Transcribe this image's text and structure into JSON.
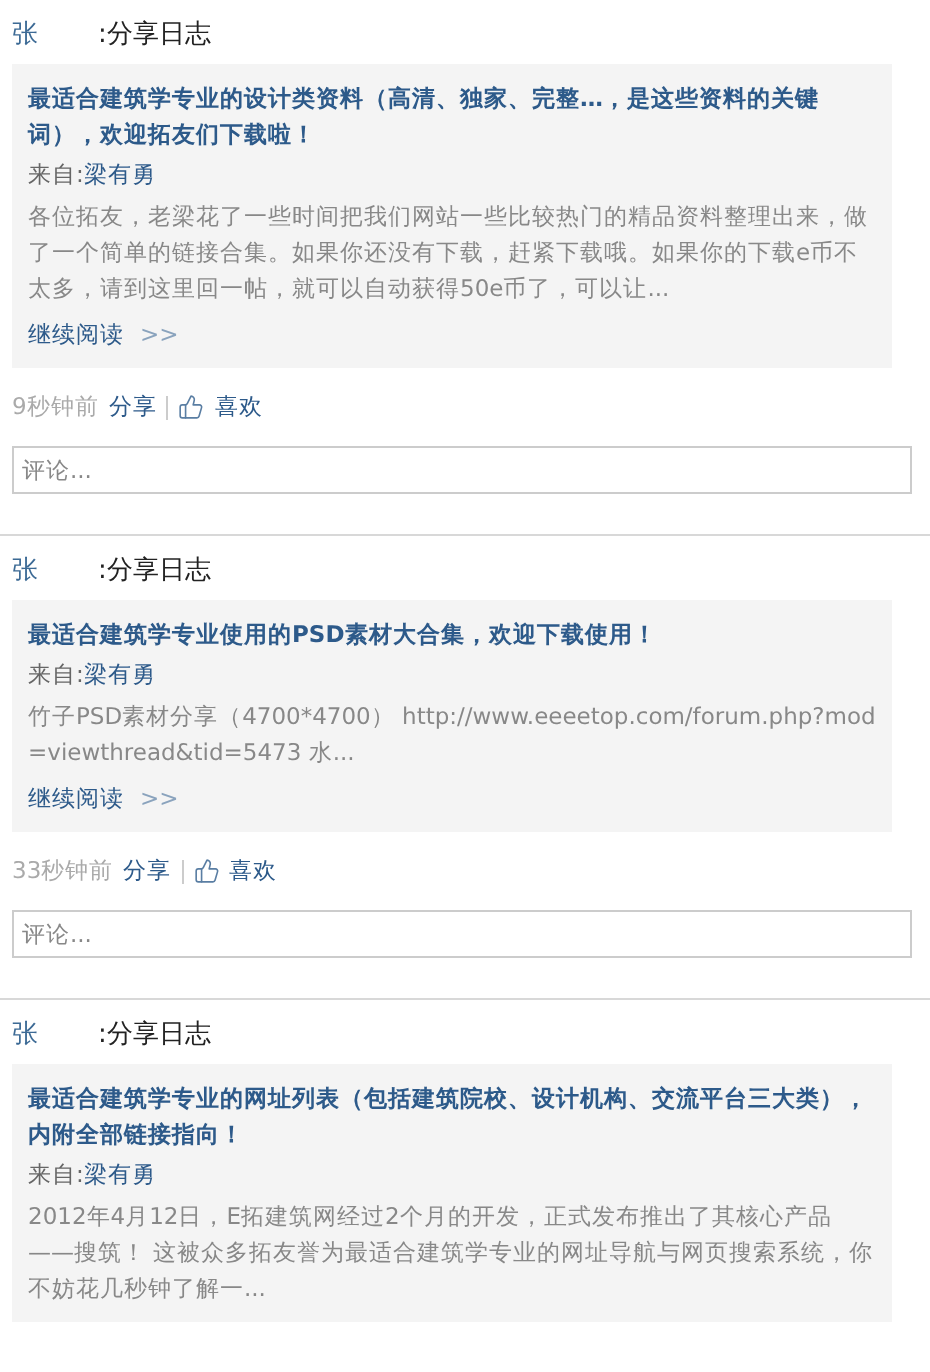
{
  "posts": [
    {
      "author": "张",
      "action": ":分享日志",
      "title": "最适合建筑学专业的设计类资料（高清、独家、完整…，是这些资料的关键词），欢迎拓友们下载啦！",
      "source_label": "来自:",
      "source": "梁有勇",
      "excerpt": "各位拓友，老梁花了一些时间把我们网站一些比较热门的精品资料整理出来，做了一个简单的链接合集。如果你还没有下载，赶紧下载哦。如果你的下载e币不太多，请到这里回一帖，就可以自动获得50e币了，可以让...",
      "read_more": "继续阅读",
      "read_more_arrow": ">>",
      "time": "9秒钟前",
      "share": "分享",
      "like": "喜欢",
      "comment_placeholder": "评论..."
    },
    {
      "author": "张",
      "action": ":分享日志",
      "title": "最适合建筑学专业使用的PSD素材大合集，欢迎下载使用！",
      "source_label": "来自:",
      "source": "梁有勇",
      "excerpt": "竹子PSD素材分享（4700*4700） http://www.eeeetop.com/forum.php?mod=viewthread&tid=5473 水...",
      "read_more": "继续阅读",
      "read_more_arrow": ">>",
      "time": "33秒钟前",
      "share": "分享",
      "like": "喜欢",
      "comment_placeholder": "评论..."
    },
    {
      "author": "张",
      "action": ":分享日志",
      "title": "最适合建筑学专业的网址列表（包括建筑院校、设计机构、交流平台三大类），内附全部链接指向！",
      "source_label": "来自:",
      "source": "梁有勇",
      "excerpt": "2012年4月12日，E拓建筑网经过2个月的开发，正式发布推出了其核心产品——搜筑！ 这被众多拓友誉为最适合建筑学专业的网址导航与网页搜索系统，你不妨花几秒钟了解一..."
    }
  ]
}
